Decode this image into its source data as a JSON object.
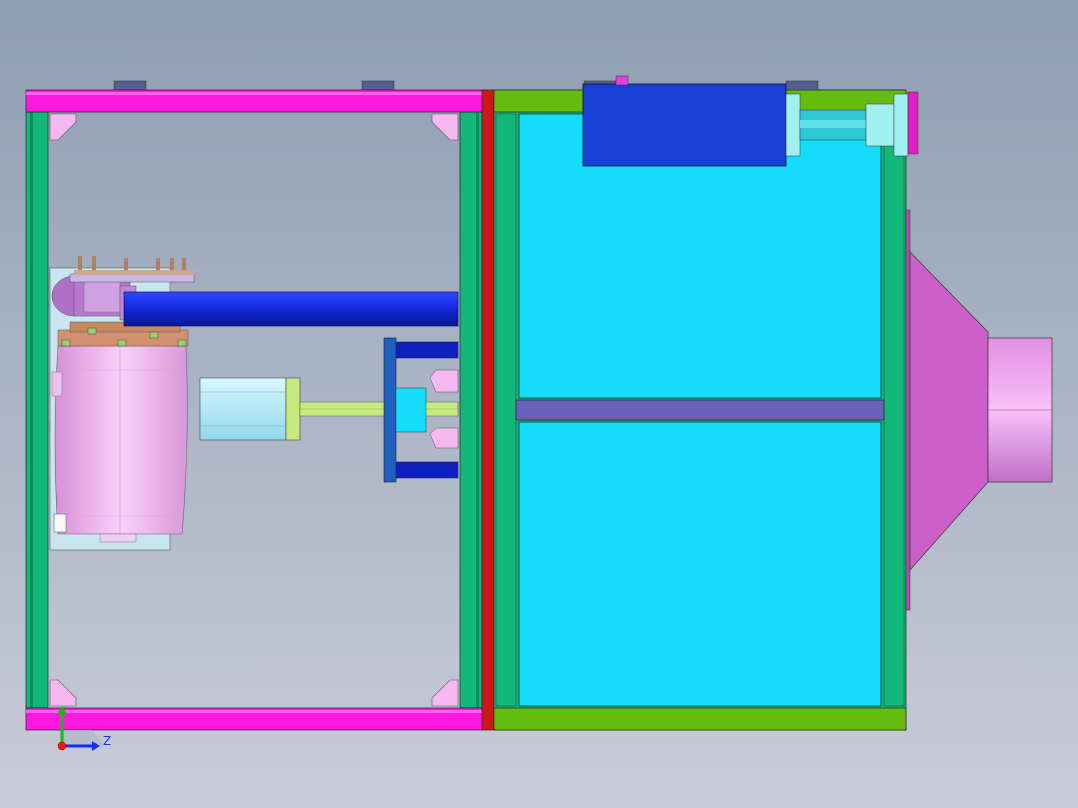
{
  "viewport": {
    "background_top": "#8e9eb2",
    "background_bottom": "#c8ccd8"
  },
  "triad": {
    "label": "Z",
    "x_color": "#1a2cff",
    "y_color": "#18b818",
    "origin_color": "#ff1010"
  },
  "colors": {
    "frame_magenta": "#ff18e0",
    "post_green": "#12b87a",
    "frame_lime": "#66bb10",
    "divider_red": "#cc1818",
    "panel_cyan": "#14dcfa",
    "block_blue": "#1840d8",
    "pipe_blue": "#1228d8",
    "hood_pink": "#cc60c8",
    "motor_pink": "#f0a8f0",
    "servo_cyan": "#a8e8f8",
    "shaft_yellow": "#c8e880",
    "crossbar_purple": "#6a62b8"
  }
}
